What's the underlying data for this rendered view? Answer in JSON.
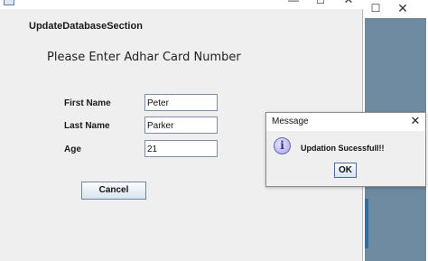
{
  "background_window": {
    "maximize_glyph": "☐",
    "close_glyph": "✕",
    "accent_color": "#6e8aa0"
  },
  "main_window": {
    "app_icon": "app-window-icon",
    "minimize_glyph": "—",
    "maximize_glyph": "☐",
    "close_glyph": "✕",
    "section_title": "UpdateDatabaseSection",
    "prompt": "Please Enter Adhar Card Number",
    "form": {
      "first_name_label": "First Name",
      "first_name_value": "Peter",
      "last_name_label": "Last Name",
      "last_name_value": "Parker",
      "age_label": "Age",
      "age_value": "21"
    },
    "cancel_label": "Cancel"
  },
  "dialog": {
    "title": "Message",
    "close_glyph": "✕",
    "icon": "info-icon",
    "icon_glyph": "i",
    "message": "Updation Sucessfull!!",
    "ok_label": "OK"
  }
}
